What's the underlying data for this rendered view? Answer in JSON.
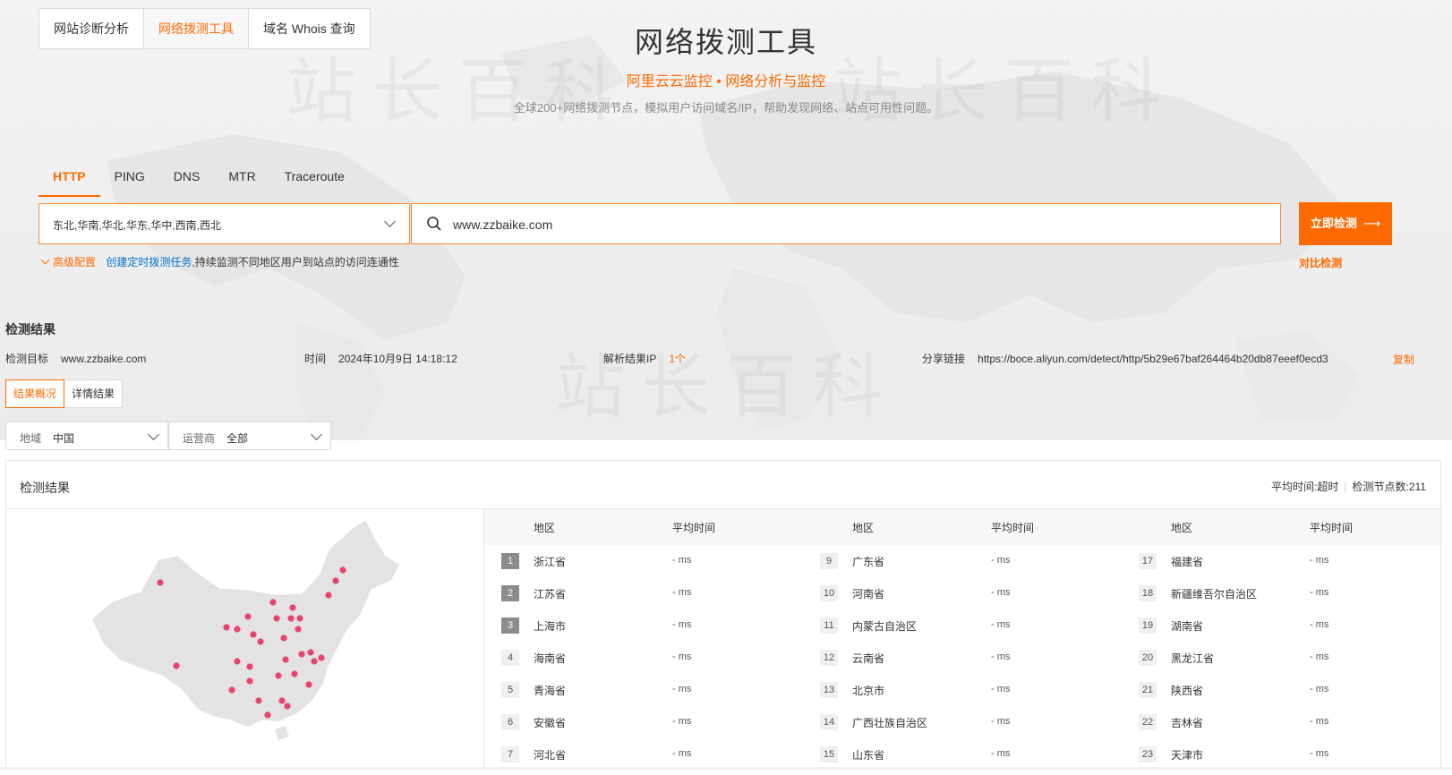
{
  "top_tabs": [
    {
      "label": "网站诊断分析"
    },
    {
      "label": "网络拨测工具"
    },
    {
      "label": "域名 Whois 查询"
    }
  ],
  "hero": {
    "title": "网络拨测工具",
    "subtitle": "阿里云云监控 • 网络分析与监控",
    "description": "全球200+网络拨测节点，模拟用户访问域名/IP，帮助发现网络、站点可用性问题。"
  },
  "watermark": "站长百科",
  "protocol_tabs": [
    "HTTP",
    "PING",
    "DNS",
    "MTR",
    "Traceroute"
  ],
  "search": {
    "regions": "东北,华南,华北,华东,华中,西南,西北",
    "url": "www.zzbaike.com",
    "submit_label": "立即检测",
    "submit_arrow": "⟶"
  },
  "advanced": {
    "label": "高级配置",
    "task_link": "创建定时拨测任务",
    "task_desc": ",持续监测不同地区用户到站点的访问连通性",
    "compare": "对比检测"
  },
  "result": {
    "title": "检测结果",
    "target_label": "检测目标",
    "target_value": "www.zzbaike.com",
    "time_label": "时间",
    "time_value": "2024年10月9日 14:18:12",
    "ip_label": "解析结果IP",
    "ip_value": "1个",
    "share_label": "分享链接",
    "share_value": "https://boce.aliyun.com/detect/http/5b29e67baf264464b20db87eeef0ecd3",
    "copy_label": "复制",
    "view_tabs": [
      "结果概况",
      "详情结果"
    ],
    "filter_region_label": "地域",
    "filter_region_value": "中国",
    "filter_isp_label": "运营商",
    "filter_isp_value": "全部"
  },
  "card": {
    "title": "检测结果",
    "avg_time": "平均时间:超时",
    "node_count": "检测节点数:211",
    "col_region": "地区",
    "col_time": "平均时间",
    "rows": [
      {
        "rank": "1",
        "name": "浙江省",
        "time": "- ms"
      },
      {
        "rank": "2",
        "name": "江苏省",
        "time": "- ms"
      },
      {
        "rank": "3",
        "name": "上海市",
        "time": "- ms"
      },
      {
        "rank": "4",
        "name": "海南省",
        "time": "- ms"
      },
      {
        "rank": "5",
        "name": "青海省",
        "time": "- ms"
      },
      {
        "rank": "6",
        "name": "安徽省",
        "time": "- ms"
      },
      {
        "rank": "7",
        "name": "河北省",
        "time": "- ms"
      },
      {
        "rank": "9",
        "name": "广东省",
        "time": "- ms"
      },
      {
        "rank": "10",
        "name": "河南省",
        "time": "- ms"
      },
      {
        "rank": "11",
        "name": "内蒙古自治区",
        "time": "- ms"
      },
      {
        "rank": "12",
        "name": "云南省",
        "time": "- ms"
      },
      {
        "rank": "13",
        "name": "北京市",
        "time": "- ms"
      },
      {
        "rank": "14",
        "name": "广西壮族自治区",
        "time": "- ms"
      },
      {
        "rank": "15",
        "name": "山东省",
        "time": "- ms"
      },
      {
        "rank": "17",
        "name": "福建省",
        "time": "- ms"
      },
      {
        "rank": "18",
        "name": "新疆维吾尔自治区",
        "time": "- ms"
      },
      {
        "rank": "19",
        "name": "湖南省",
        "time": "- ms"
      },
      {
        "rank": "20",
        "name": "黑龙江省",
        "time": "- ms"
      },
      {
        "rank": "21",
        "name": "陕西省",
        "time": "- ms"
      },
      {
        "rank": "22",
        "name": "吉林省",
        "time": "- ms"
      },
      {
        "rank": "23",
        "name": "天津市",
        "time": "- ms"
      }
    ]
  },
  "colors": {
    "accent": "#ff6a00",
    "link": "#0070cc",
    "map_fill": "#e3e3e3",
    "map_dot": "#e8436b"
  }
}
